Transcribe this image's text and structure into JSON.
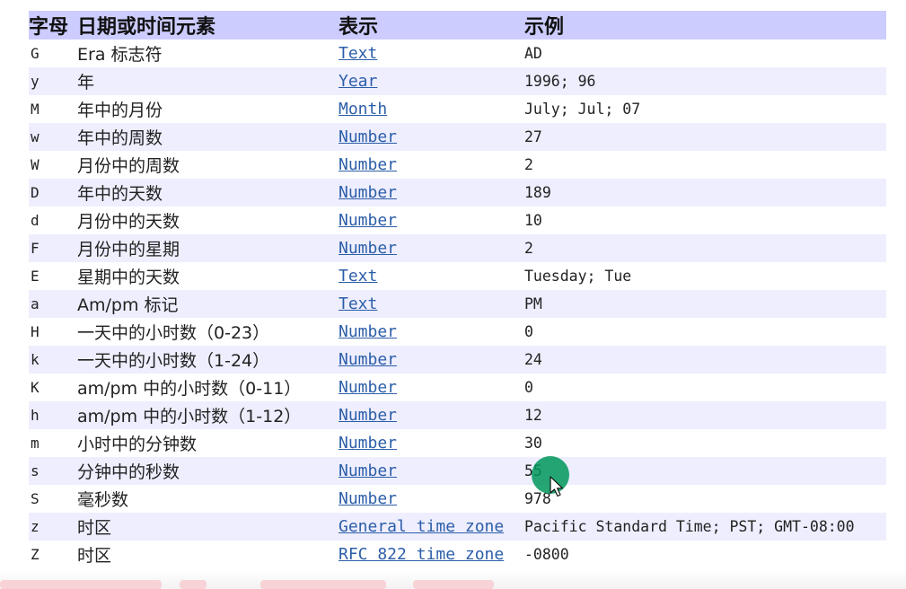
{
  "table": {
    "headers": {
      "letter": "字母",
      "element": "日期或时间元素",
      "representation": "表示",
      "example": "示例"
    },
    "rows": [
      {
        "letter": "G",
        "element": "Era 标志符",
        "representation": "Text",
        "example": "AD"
      },
      {
        "letter": "y",
        "element": "年",
        "representation": "Year",
        "example": "1996; 96"
      },
      {
        "letter": "M",
        "element": "年中的月份",
        "representation": "Month",
        "example": "July; Jul; 07"
      },
      {
        "letter": "w",
        "element": "年中的周数",
        "representation": "Number",
        "example": "27"
      },
      {
        "letter": "W",
        "element": "月份中的周数",
        "representation": "Number",
        "example": "2"
      },
      {
        "letter": "D",
        "element": "年中的天数",
        "representation": "Number",
        "example": "189"
      },
      {
        "letter": "d",
        "element": "月份中的天数",
        "representation": "Number",
        "example": "10"
      },
      {
        "letter": "F",
        "element": "月份中的星期",
        "representation": "Number",
        "example": "2"
      },
      {
        "letter": "E",
        "element": "星期中的天数",
        "representation": "Text",
        "example": "Tuesday; Tue"
      },
      {
        "letter": "a",
        "element": "Am/pm 标记",
        "representation": "Text",
        "example": "PM"
      },
      {
        "letter": "H",
        "element": "一天中的小时数（0-23）",
        "representation": "Number",
        "example": "0"
      },
      {
        "letter": "k",
        "element": "一天中的小时数（1-24）",
        "representation": "Number",
        "example": "24"
      },
      {
        "letter": "K",
        "element": "am/pm 中的小时数（0-11）",
        "representation": "Number",
        "example": "0"
      },
      {
        "letter": "h",
        "element": "am/pm 中的小时数（1-12）",
        "representation": "Number",
        "example": "12"
      },
      {
        "letter": "m",
        "element": "小时中的分钟数",
        "representation": "Number",
        "example": "30"
      },
      {
        "letter": "s",
        "element": "分钟中的秒数",
        "representation": "Number",
        "example": "55"
      },
      {
        "letter": "S",
        "element": "毫秒数",
        "representation": "Number",
        "example": "978"
      },
      {
        "letter": "z",
        "element": "时区",
        "representation": "General time zone",
        "example": "Pacific Standard Time; PST; GMT-08:00"
      },
      {
        "letter": "Z",
        "element": "时区",
        "representation": "RFC 822 time zone",
        "example": "-0800"
      }
    ]
  },
  "colors": {
    "header_background": "#ccccff",
    "alternate_row_background": "#eeeeff",
    "link": "#2c5ea8",
    "cursor_highlight": "#00965a"
  },
  "icons": {
    "cursor": "mouse-pointer-icon"
  }
}
